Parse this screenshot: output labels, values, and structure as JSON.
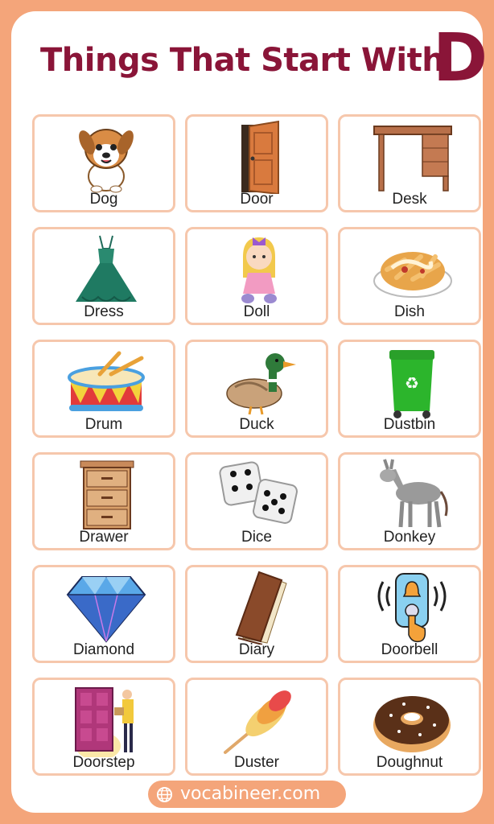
{
  "title": "Things That Start With",
  "letter": "D",
  "items": [
    {
      "label": "Dog",
      "icon": "dog-icon"
    },
    {
      "label": "Door",
      "icon": "door-icon"
    },
    {
      "label": "Desk",
      "icon": "desk-icon"
    },
    {
      "label": "Dress",
      "icon": "dress-icon"
    },
    {
      "label": "Doll",
      "icon": "doll-icon"
    },
    {
      "label": "Dish",
      "icon": "dish-icon"
    },
    {
      "label": "Drum",
      "icon": "drum-icon"
    },
    {
      "label": "Duck",
      "icon": "duck-icon"
    },
    {
      "label": "Dustbin",
      "icon": "dustbin-icon"
    },
    {
      "label": "Drawer",
      "icon": "drawer-icon"
    },
    {
      "label": "Dice",
      "icon": "dice-icon"
    },
    {
      "label": "Donkey",
      "icon": "donkey-icon"
    },
    {
      "label": "Diamond",
      "icon": "diamond-icon"
    },
    {
      "label": "Diary",
      "icon": "diary-icon"
    },
    {
      "label": "Doorbell",
      "icon": "doorbell-icon"
    },
    {
      "label": "Doorstep",
      "icon": "doorstep-icon"
    },
    {
      "label": "Duster",
      "icon": "duster-icon"
    },
    {
      "label": "Doughnut",
      "icon": "doughnut-icon"
    }
  ],
  "footer": {
    "url": "vocabineer.com",
    "icon": "globe-icon"
  },
  "colors": {
    "background": "#f4a57a",
    "title": "#8a1538",
    "tile_border": "#f6c7ac"
  }
}
